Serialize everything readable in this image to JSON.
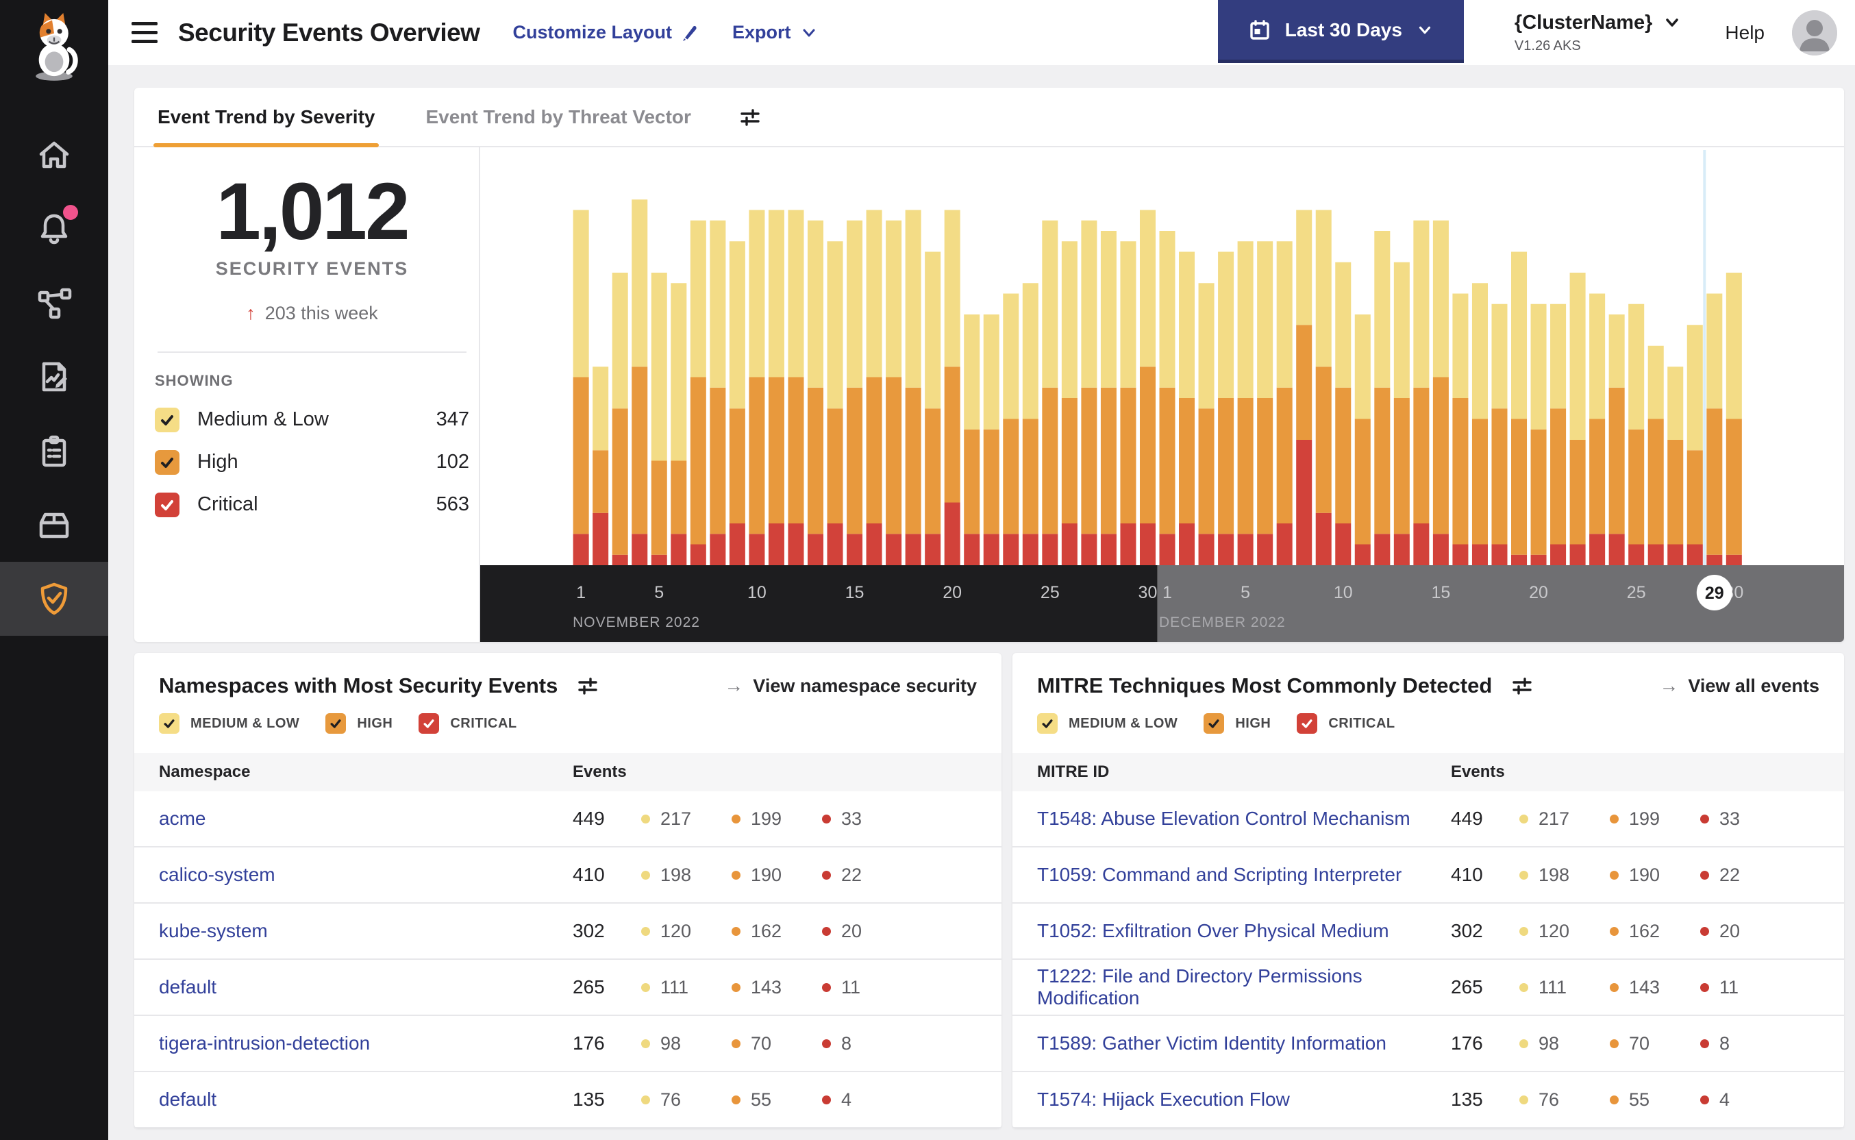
{
  "header": {
    "title": "Security Events Overview",
    "customize_label": "Customize Layout",
    "export_label": "Export",
    "date_range_label": "Last 30 Days",
    "cluster_name": "{ClusterName}",
    "cluster_version": "V1.26 AKS",
    "help_label": "Help"
  },
  "sidebar": {
    "items": [
      "home",
      "notifications",
      "service-graph",
      "policies",
      "compliance",
      "workloads",
      "threat-defense"
    ],
    "active_item": "threat-defense",
    "notification_dot_color": "#f0538c"
  },
  "top_card": {
    "tabs": [
      {
        "label": "Event Trend by Severity",
        "active": true
      },
      {
        "label": "Event Trend by Threat Vector",
        "active": false
      }
    ],
    "stat": {
      "value": "1,012",
      "label": "SECURITY EVENTS",
      "delta_arrow": "↑",
      "delta": "203 this week"
    },
    "showing": {
      "label": "SHOWING",
      "items": [
        {
          "label": "Medium & Low",
          "value": "347",
          "severity": "medium_low",
          "checked": true
        },
        {
          "label": "High",
          "value": "102",
          "severity": "high",
          "checked": true
        },
        {
          "label": "Critical",
          "value": "563",
          "severity": "critical",
          "checked": true
        }
      ]
    }
  },
  "chart_data": {
    "type": "bar",
    "stacked": true,
    "title": "Event Trend by Severity",
    "grid": false,
    "legend_position": "left-panel-checkboxes",
    "series_names": [
      "Medium & Low",
      "High",
      "Critical"
    ],
    "colors": {
      "medium_low": "#F3DC86",
      "high": "#E8993D",
      "critical": "#D2423A"
    },
    "scale_max": 40,
    "months": [
      {
        "label": "NOVEMBER 2022",
        "days": 30,
        "ticks": [
          1,
          5,
          10,
          15,
          20,
          25,
          30
        ],
        "band_color": "#1d1d1f"
      },
      {
        "label": "DECEMBER 2022",
        "days": 30,
        "ticks": [
          1,
          5,
          10,
          15,
          20,
          25,
          30
        ],
        "band_color": "#6f6f72"
      }
    ],
    "values": [
      [
        16,
        15,
        3
      ],
      [
        8,
        6,
        5
      ],
      [
        13,
        14,
        1
      ],
      [
        16,
        16,
        3
      ],
      [
        18,
        9,
        1
      ],
      [
        17,
        7,
        3
      ],
      [
        15,
        16,
        2
      ],
      [
        16,
        14,
        3
      ],
      [
        16,
        11,
        4
      ],
      [
        16,
        15,
        3
      ],
      [
        16,
        14,
        4
      ],
      [
        16,
        14,
        4
      ],
      [
        16,
        14,
        3
      ],
      [
        16,
        11,
        4
      ],
      [
        16,
        14,
        3
      ],
      [
        16,
        14,
        4
      ],
      [
        15,
        15,
        3
      ],
      [
        17,
        14,
        3
      ],
      [
        15,
        12,
        3
      ],
      [
        15,
        13,
        6
      ],
      [
        11,
        10,
        3
      ],
      [
        11,
        10,
        3
      ],
      [
        12,
        11,
        3
      ],
      [
        13,
        11,
        3
      ],
      [
        16,
        14,
        3
      ],
      [
        15,
        12,
        4
      ],
      [
        16,
        14,
        3
      ],
      [
        15,
        14,
        3
      ],
      [
        14,
        13,
        4
      ],
      [
        15,
        15,
        4
      ],
      [
        15,
        14,
        3
      ],
      [
        14,
        12,
        4
      ],
      [
        12,
        12,
        3
      ],
      [
        14,
        13,
        3
      ],
      [
        15,
        13,
        3
      ],
      [
        15,
        13,
        3
      ],
      [
        14,
        13,
        4
      ],
      [
        11,
        11,
        12
      ],
      [
        15,
        14,
        5
      ],
      [
        12,
        13,
        4
      ],
      [
        10,
        12,
        2
      ],
      [
        15,
        14,
        3
      ],
      [
        13,
        13,
        3
      ],
      [
        16,
        13,
        4
      ],
      [
        15,
        15,
        3
      ],
      [
        10,
        14,
        2
      ],
      [
        13,
        12,
        2
      ],
      [
        10,
        13,
        2
      ],
      [
        16,
        13,
        1
      ],
      [
        12,
        12,
        1
      ],
      [
        10,
        13,
        2
      ],
      [
        16,
        10,
        2
      ],
      [
        12,
        11,
        3
      ],
      [
        7,
        14,
        3
      ],
      [
        12,
        11,
        2
      ],
      [
        7,
        12,
        2
      ],
      [
        7,
        10,
        2
      ],
      [
        12,
        9,
        2
      ],
      [
        11,
        14,
        1
      ],
      [
        14,
        13,
        1
      ]
    ],
    "highlight": {
      "index": 58,
      "day_label": "29",
      "line_color": "#d8ecf8"
    }
  },
  "namespaces_card": {
    "title": "Namespaces with Most Security Events",
    "link_arrow": "→",
    "link_label": "View namespace security",
    "filters": [
      {
        "label": "MEDIUM & LOW",
        "severity": "medium_low",
        "checked": true
      },
      {
        "label": "HIGH",
        "severity": "high",
        "checked": true
      },
      {
        "label": "CRITICAL",
        "severity": "critical",
        "checked": true
      }
    ],
    "columns": [
      "Namespace",
      "Events"
    ],
    "rows": [
      {
        "name": "acme",
        "total": "449",
        "ml": "217",
        "high": "199",
        "critical": "33"
      },
      {
        "name": "calico-system",
        "total": "410",
        "ml": "198",
        "high": "190",
        "critical": "22"
      },
      {
        "name": "kube-system",
        "total": "302",
        "ml": "120",
        "high": "162",
        "critical": "20"
      },
      {
        "name": "default",
        "total": "265",
        "ml": "111",
        "high": "143",
        "critical": "11"
      },
      {
        "name": "tigera-intrusion-detection",
        "total": "176",
        "ml": "98",
        "high": "70",
        "critical": "8"
      },
      {
        "name": "default",
        "total": "135",
        "ml": "76",
        "high": "55",
        "critical": "4"
      }
    ]
  },
  "mitre_card": {
    "title": "MITRE Techniques Most Commonly Detected",
    "link_arrow": "→",
    "link_label": "View all events",
    "filters": [
      {
        "label": "MEDIUM & LOW",
        "severity": "medium_low",
        "checked": true
      },
      {
        "label": "HIGH",
        "severity": "high",
        "checked": true
      },
      {
        "label": "CRITICAL",
        "severity": "critical",
        "checked": true
      }
    ],
    "columns": [
      "MITRE ID",
      "Events"
    ],
    "rows": [
      {
        "name": "T1548: Abuse Elevation Control Mechanism",
        "total": "449",
        "ml": "217",
        "high": "199",
        "critical": "33"
      },
      {
        "name": "T1059: Command and Scripting Interpreter",
        "total": "410",
        "ml": "198",
        "high": "190",
        "critical": "22"
      },
      {
        "name": "T1052: Exfiltration Over Physical Medium",
        "total": "302",
        "ml": "120",
        "high": "162",
        "critical": "20"
      },
      {
        "name": "T1222: File and Directory Permissions Modification",
        "total": "265",
        "ml": "111",
        "high": "143",
        "critical": "11"
      },
      {
        "name": "T1589: Gather Victim Identity Information",
        "total": "176",
        "ml": "98",
        "high": "70",
        "critical": "8"
      },
      {
        "name": "T1574: Hijack Execution Flow",
        "total": "135",
        "ml": "76",
        "high": "55",
        "critical": "4"
      }
    ]
  }
}
